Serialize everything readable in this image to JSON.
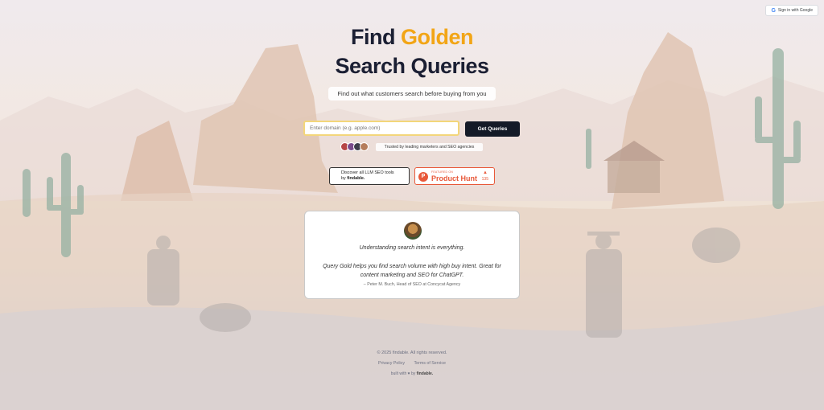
{
  "header": {
    "signin_label": "Sign in with Google",
    "google_glyph": "G"
  },
  "hero": {
    "title_part1": "Find ",
    "title_gold": "Golden",
    "title_line2": "Search Queries",
    "subtitle": "Find out what customers search before buying from you",
    "gold_color": "#f2a516"
  },
  "search": {
    "placeholder": "Enter domain (e.g. apple.com)",
    "value": "",
    "button_label": "Get Queries"
  },
  "trust": {
    "text": "Trusted by leading marketers and SEO agencies"
  },
  "badges": {
    "llm_line1": "Discover all LLM SEO tools",
    "llm_line2_prefix": "by ",
    "llm_brand": "findable.",
    "ph_letter": "P",
    "ph_featured": "FEATURED ON",
    "ph_name": "Product Hunt",
    "ph_arrow": "▲",
    "ph_count": "135"
  },
  "testimonial": {
    "quote_lead": "Understanding search intent is everything.",
    "quote_body": "Query Gold helps you find search volume with high buy intent. Great for content marketing and SEO for ChatGPT.",
    "attribution": "– Peter M. Buch, Head of SEO at Concycat Agency"
  },
  "footer": {
    "copyright": "© 2025 findable. All rights reserved.",
    "privacy": "Privacy Policy",
    "terms": "Terms of Service",
    "built_prefix": "built with ♥ by ",
    "built_brand": "findable."
  }
}
